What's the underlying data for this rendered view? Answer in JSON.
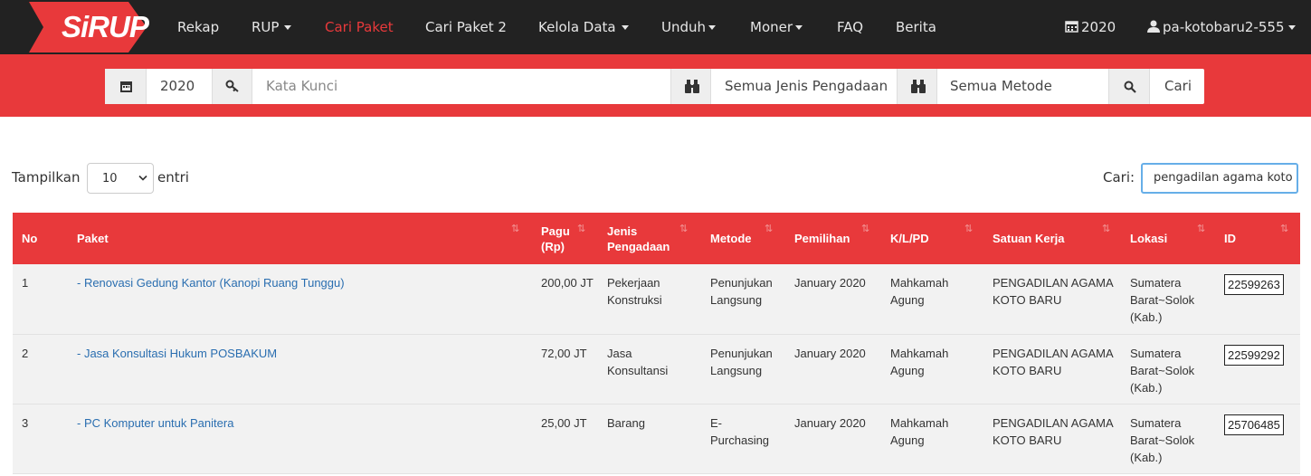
{
  "brand": {
    "logo_text": "SiRUP"
  },
  "nav": {
    "items": [
      {
        "label": "Rekap"
      },
      {
        "label": "RUP"
      },
      {
        "label": "Cari Paket"
      },
      {
        "label": "Cari Paket 2"
      },
      {
        "label": "Kelola Data"
      },
      {
        "label": "Unduh"
      },
      {
        "label": "Moner"
      },
      {
        "label": "FAQ"
      },
      {
        "label": "Berita"
      }
    ],
    "year": "2020",
    "user": "pa-kotobaru2-555"
  },
  "search": {
    "year": "2020",
    "keyword_placeholder": "Kata Kunci",
    "jenis": "Semua Jenis Pengadaan",
    "metode": "Semua Metode",
    "button": "Cari"
  },
  "controls": {
    "show_label": "Tampilkan",
    "show_value": "10",
    "entries_label": "entri",
    "filter_label": "Cari:",
    "filter_value": "pengadilan agama koto"
  },
  "table": {
    "columns": {
      "no": "No",
      "paket": "Paket",
      "pagu": "Pagu (Rp)",
      "jenis": "Jenis Pengadaan",
      "metode": "Metode",
      "pemilihan": "Pemilihan",
      "klpd": "K/L/PD",
      "satker": "Satuan Kerja",
      "lokasi": "Lokasi",
      "id": "ID"
    },
    "rows": [
      {
        "no": "1",
        "paket": "- Renovasi Gedung Kantor (Kanopi Ruang Tunggu)",
        "pagu": "200,00 JT",
        "jenis": "Pekerjaan Konstruksi",
        "metode": "Penunjukan Langsung",
        "pemilihan": "January 2020",
        "klpd": "Mahkamah Agung",
        "satker": "PENGADILAN AGAMA KOTO BARU",
        "lokasi": "Sumatera Barat~Solok (Kab.)",
        "id": "22599263"
      },
      {
        "no": "2",
        "paket": "- Jasa Konsultasi Hukum POSBAKUM",
        "pagu": "72,00 JT",
        "jenis": "Jasa Konsultansi",
        "metode": "Penunjukan Langsung",
        "pemilihan": "January 2020",
        "klpd": "Mahkamah Agung",
        "satker": "PENGADILAN AGAMA KOTO BARU",
        "lokasi": "Sumatera Barat~Solok (Kab.)",
        "id": "22599292"
      },
      {
        "no": "3",
        "paket": "- PC Komputer untuk Panitera",
        "pagu": "25,00 JT",
        "jenis": "Barang",
        "metode": "E-Purchasing",
        "pemilihan": "January 2020",
        "klpd": "Mahkamah Agung",
        "satker": "PENGADILAN AGAMA KOTO BARU",
        "lokasi": "Sumatera Barat~Solok (Kab.)",
        "id": "25706485"
      }
    ]
  },
  "colors": {
    "accent": "#e8393b",
    "navbar": "#222222",
    "link": "#2a6eb0"
  }
}
